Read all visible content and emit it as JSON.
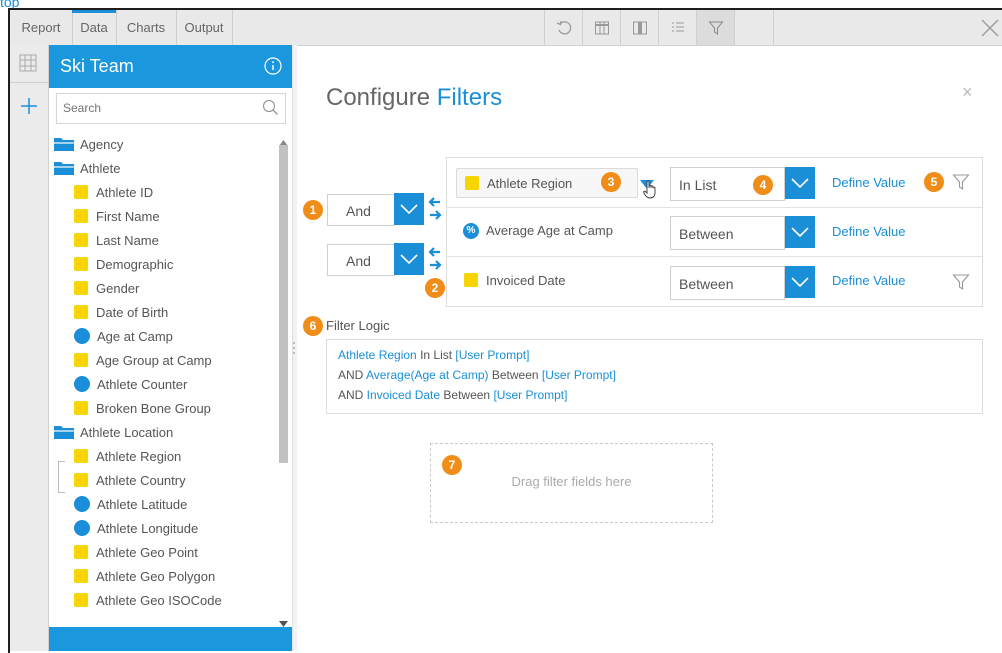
{
  "top_link": "top",
  "toolbar": {
    "tabs": [
      "Report",
      "Data",
      "Charts",
      "Output"
    ],
    "active_tab": "Data"
  },
  "sidebar": {
    "title": "Ski Team",
    "search_placeholder": "Search",
    "items": [
      {
        "label": "Agency",
        "type": "folder"
      },
      {
        "label": "Athlete",
        "type": "folder"
      },
      {
        "label": "Athlete ID",
        "type": "dimension"
      },
      {
        "label": "First Name",
        "type": "dimension"
      },
      {
        "label": "Last Name",
        "type": "dimension"
      },
      {
        "label": "Demographic",
        "type": "dimension"
      },
      {
        "label": "Gender",
        "type": "dimension"
      },
      {
        "label": "Date of Birth",
        "type": "dimension"
      },
      {
        "label": "Age at Camp",
        "type": "metric"
      },
      {
        "label": "Age Group at Camp",
        "type": "dimension"
      },
      {
        "label": "Athlete Counter",
        "type": "metric"
      },
      {
        "label": "Broken Bone Group",
        "type": "dimension"
      },
      {
        "label": "Athlete Location",
        "type": "folder"
      },
      {
        "label": "Athlete Region",
        "type": "dimension"
      },
      {
        "label": "Athlete Country",
        "type": "dimension"
      },
      {
        "label": "Athlete Latitude",
        "type": "metric"
      },
      {
        "label": "Athlete Longitude",
        "type": "metric"
      },
      {
        "label": "Athlete Geo Point",
        "type": "dimension"
      },
      {
        "label": "Athlete Geo Polygon",
        "type": "dimension"
      },
      {
        "label": "Athlete Geo ISOCode",
        "type": "dimension"
      }
    ]
  },
  "main": {
    "title_part1": "Configure",
    "title_part2": "Filters",
    "close_glyph": "×",
    "connectors": [
      "And",
      "And"
    ],
    "filters": [
      {
        "field": "Athlete Region",
        "icon": "yellow-square",
        "operator": "In List",
        "define": "Define Value",
        "has_filter_icon": true
      },
      {
        "field": "Average Age at Camp",
        "icon": "percent-circle",
        "operator": "Between",
        "define": "Define Value",
        "has_filter_icon": false
      },
      {
        "field": "Invoiced Date",
        "icon": "yellow-square",
        "operator": "Between",
        "define": "Define Value",
        "has_filter_icon": true
      }
    ],
    "badges": [
      "1",
      "2",
      "3",
      "4",
      "5",
      "6",
      "7"
    ],
    "logic_label": "Filter Logic",
    "logic_lines": [
      {
        "prefix": "",
        "field": "Athlete Region",
        "op": " In List ",
        "value": "[User Prompt]"
      },
      {
        "prefix": "AND ",
        "field": "Average(Age at Camp)",
        "op": " Between ",
        "value": "[User Prompt]"
      },
      {
        "prefix": "AND ",
        "field": "Invoiced Date",
        "op": " Between ",
        "value": "[User Prompt]"
      }
    ],
    "dropzone_text": "Drag filter fields here",
    "percent_glyph": "%"
  },
  "colors": {
    "accent": "#1a8fd8",
    "badge": "#f08c18",
    "dimension": "#f5d400"
  }
}
